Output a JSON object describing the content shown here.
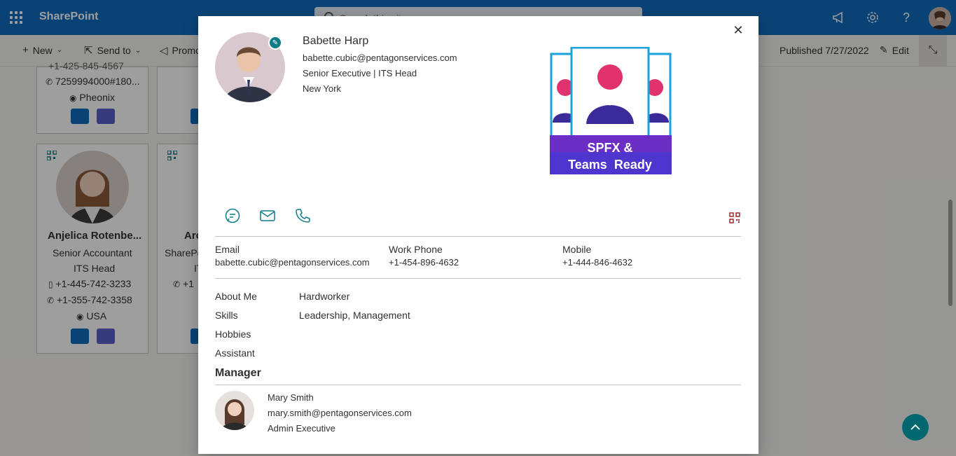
{
  "suite": {
    "app_name": "SharePoint",
    "search_placeholder": "Search this site"
  },
  "commands": {
    "new": "New",
    "send_to": "Send to",
    "promote": "Promote",
    "published": "Published 7/27/2022",
    "edit": "Edit"
  },
  "background_cards": [
    {
      "partial_line": "+1-425-845-4567",
      "phone": "7259994000#180...",
      "location": "Pheonix"
    },
    {
      "name": "Anjelica Rotenbe...",
      "title": "Senior Accountant",
      "department": "ITS Head",
      "mobile": "+1-445-742-3233",
      "phone": "+1-355-742-3358",
      "location": "USA"
    },
    {
      "name_partial": "Aro",
      "title_partial": "SharePo",
      "dept_partial": "IT",
      "phone_partial": "+1"
    }
  ],
  "profile": {
    "name": "Babette Harp",
    "email": "babette.cubic@pentagonservices.com",
    "title": "Senior Executive | ITS Head",
    "location": "New York",
    "promo_line1": "SPFX &",
    "promo_line2": "Teams  Ready"
  },
  "contact": {
    "email_label": "Email",
    "email_value": "babette.cubic@pentagonservices.com",
    "work_phone_label": "Work Phone",
    "work_phone_value": "+1-454-896-4632",
    "mobile_label": "Mobile",
    "mobile_value": "+1-444-846-4632"
  },
  "details": [
    {
      "label": "About Me",
      "value": "Hardworker"
    },
    {
      "label": "Skills",
      "value": "Leadership, Management"
    },
    {
      "label": "Hobbies",
      "value": ""
    },
    {
      "label": "Assistant",
      "value": ""
    }
  ],
  "manager": {
    "heading": "Manager",
    "name": "Mary Smith",
    "email": "mary.smith@pentagonservices.com",
    "title": "Admin Executive"
  },
  "colors": {
    "suite_bar": "#0f6cbd",
    "accent_teal": "#0e7c86",
    "qr_red": "#a4262c",
    "fab": "#00676e"
  }
}
